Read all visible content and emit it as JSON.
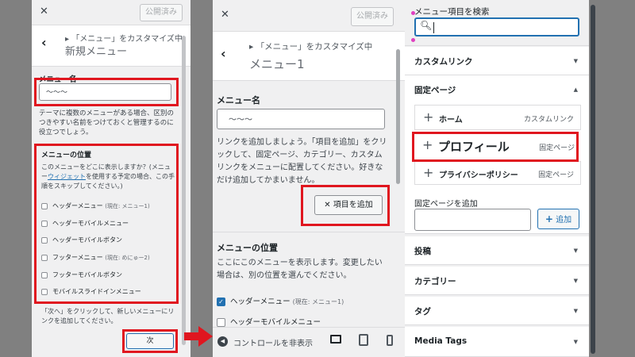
{
  "left": {
    "publish": "公開済み",
    "breadcrumb": "「メニュー」をカスタマイズ中",
    "title": "新規メニュー",
    "menu_name_label": "メニュー名",
    "menu_name_value": "〜〜〜",
    "help": "テーマに複数のメニューがある場合、区別のつきやすい名前をつけておくと管理するのに役立つでしょう。",
    "location_label": "メニューの位置",
    "location_help_1": "このメニューをどこに表示しますか？(メニュー",
    "location_help_link": "ウィジェット",
    "location_help_2": "を使用する予定の場合、この手順をスキップしてください。)",
    "locations": [
      {
        "label": "ヘッダーメニュー",
        "hint": "(現在: メニュー1)"
      },
      {
        "label": "ヘッダーモバイルメニュー",
        "hint": ""
      },
      {
        "label": "ヘッダーモバイルボタン",
        "hint": ""
      },
      {
        "label": "フッターメニュー",
        "hint": "(現在: めにゅー2)"
      },
      {
        "label": "フッターモバイルボタン",
        "hint": ""
      },
      {
        "label": "モバイルスライドインメニュー",
        "hint": ""
      }
    ],
    "next_help": "「次へ」をクリックして、新しいメニューにリンクを追加してください。",
    "next_button": "次"
  },
  "middle": {
    "publish": "公開済み",
    "breadcrumb": "「メニュー」をカスタマイズ中",
    "title": "メニュー1",
    "menu_name_label": "メニュー名",
    "help": "リンクを追加しましょう。「項目を追加」をクリックして、固定ページ、カテゴリー、カスタムリンクをメニューに配置してください。好きなだけ追加してかまいません。",
    "add_items_button": "項目を追加",
    "location_label": "メニューの位置",
    "location_help": "ここにこのメニューを表示します。変更したい場合は、別の位置を選んでください。",
    "locations": [
      {
        "label": "ヘッダーメニュー",
        "hint": "(現在: メニュー1)",
        "checked": true
      },
      {
        "label": "ヘッダーモバイルメニュー",
        "hint": "",
        "checked": false
      }
    ],
    "hide_controls": "コントロールを非表示"
  },
  "right": {
    "search_label": "メニュー項目を検索",
    "search_value": "",
    "sections": {
      "custom_links": "カスタムリンク",
      "pages": "固定ページ",
      "posts": "投稿",
      "categories": "カテゴリー",
      "tags": "タグ",
      "media_tags": "Media Tags"
    },
    "page_items": [
      {
        "name": "ホーム",
        "type": "カスタムリンク"
      },
      {
        "name": "プロフィール",
        "type": "固定ページ"
      },
      {
        "name": "プライバシーポリシー",
        "type": "固定ページ"
      }
    ],
    "add_page_label": "固定ページを追加",
    "add_button": "追加"
  },
  "colors": {
    "highlight": "#e0161f",
    "accent": "#2271b1"
  }
}
